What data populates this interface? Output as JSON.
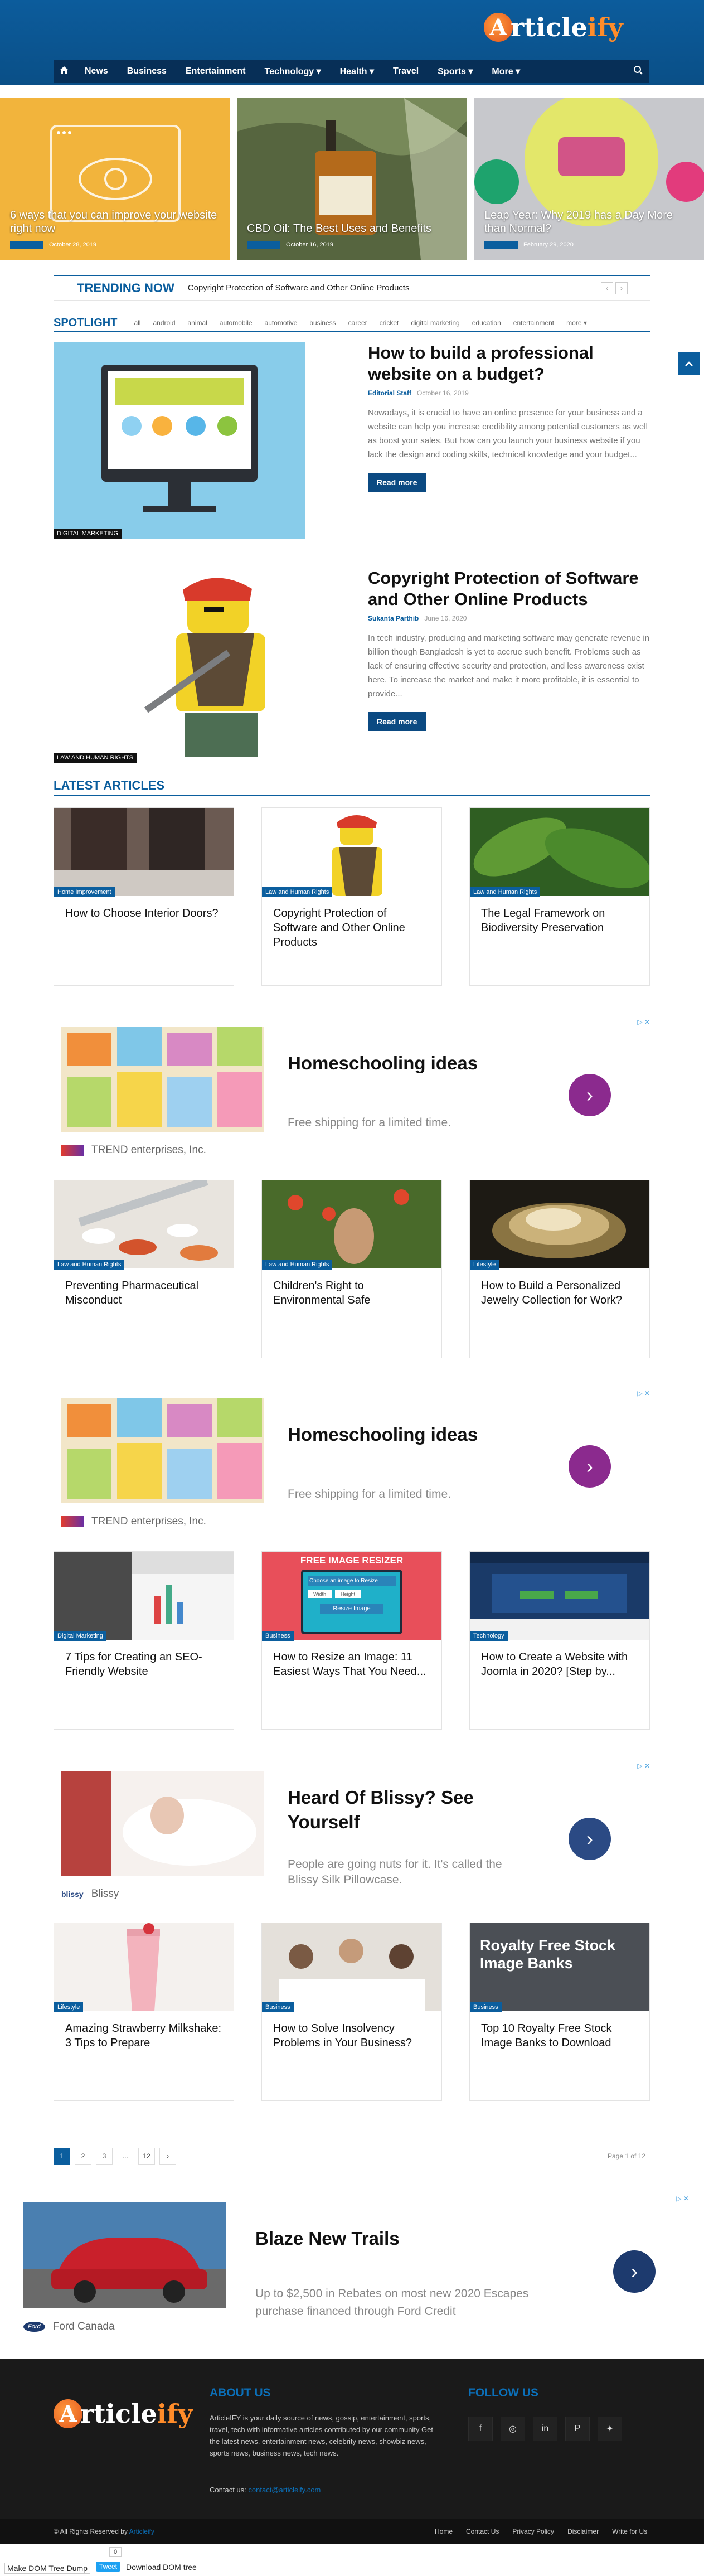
{
  "brand": {
    "logo_letter": "A",
    "logo_rest": "rticle",
    "logo_accent": "ify",
    "accent": "#0b5e9e",
    "header_bg": "#0a4f87"
  },
  "nav": {
    "items": [
      "News",
      "Business",
      "Entertainment",
      "Technology",
      "Health",
      "Travel",
      "Sports",
      "More"
    ],
    "dropdown_marker": "▾"
  },
  "hero": [
    {
      "title": "6 ways that you can improve your website right now",
      "date": "October 28, 2019"
    },
    {
      "title": "CBD Oil: The Best Uses and Benefits",
      "date": "October 16, 2019"
    },
    {
      "title": "Leap Year: Why 2019 has a Day More than Normal?",
      "date": "February 29, 2020"
    }
  ],
  "trending": {
    "label": "TRENDING NOW",
    "headline": "Copyright Protection of Software and Other Online Products",
    "prev": "‹",
    "next": "›"
  },
  "spotlight": {
    "label": "SPOTLIGHT",
    "filters": [
      "all",
      "android",
      "animal",
      "automobile",
      "automotive",
      "business",
      "career",
      "cricket",
      "digital marketing",
      "education",
      "entertainment",
      "more ▾"
    ],
    "posts": [
      {
        "category": "DIGITAL MARKETING",
        "title": "How to build a professional website on a budget?",
        "author": "Editorial Staff",
        "date": "October 16, 2019",
        "excerpt": "Nowadays, it is crucial to have an online presence for your business and a website can help you increase credibility among potential customers as well as boost your sales. But how can you launch your business website if you lack the design and coding skills, technical knowledge and your budget...",
        "button": "Read more"
      },
      {
        "category": "LAW AND HUMAN RIGHTS",
        "title": "Copyright Protection of Software and Other Online Products",
        "author": "Sukanta Parthib",
        "date": "June 16, 2020",
        "excerpt": "In tech industry, producing and marketing software may generate revenue in billion though Bangladesh is yet to accrue such benefit. Problems such as lack of ensuring effective security and protection, and less awareness exist here. To increase the market and make it more profitable, it is essential to provide...",
        "button": "Read more"
      }
    ]
  },
  "latest": {
    "label": "LATEST ARTICLES",
    "cards": [
      {
        "category": "Home Improvement",
        "title": "How to Choose Interior Doors?"
      },
      {
        "category": "Law and Human Rights",
        "title": "Copyright Protection of Software and Other Online Products"
      },
      {
        "category": "Law and Human Rights",
        "title": "The Legal Framework on Biodiversity Preservation"
      },
      {
        "category": "Law and Human Rights",
        "title": "Preventing Pharmaceutical Misconduct"
      },
      {
        "category": "Law and Human Rights",
        "title": "Children's Right to Environmental Safe"
      },
      {
        "category": "Lifestyle",
        "title": "How to Build a Personalized Jewelry Collection for Work?"
      },
      {
        "category": "Digital Marketing",
        "title": "7 Tips for Creating an SEO-Friendly Website"
      },
      {
        "category": "Business",
        "title": "How to Resize an Image: 11 Easiest Ways That You Need..."
      },
      {
        "category": "Technology",
        "title": "How to Create a Website with Joomla in 2020? [Step by..."
      },
      {
        "category": "Lifestyle",
        "title": "Amazing Strawberry Milkshake: 3 Tips to Prepare"
      },
      {
        "category": "Business",
        "title": "How to Solve Insolvency Problems in Your Business?"
      },
      {
        "category": "Business",
        "title": "Top 10 Royalty Free Stock Image Banks to Download"
      }
    ],
    "resizer_banner": "FREE IMAGE RESIZER",
    "resizer_input": "Choose an image to Resize",
    "resizer_width": "Width",
    "resizer_height": "Height",
    "resizer_btn": "Resize Image",
    "stock_banner": "Royalty Free Stock Image Banks"
  },
  "ads": [
    {
      "title": "Homeschooling ideas",
      "sub": "Free shipping for a limited time.",
      "advertiser": "TREND enterprises, Inc.",
      "go": "›",
      "adchoice": "▷ ✕"
    },
    {
      "title": "Homeschooling ideas",
      "sub": "Free shipping for a limited time.",
      "advertiser": "TREND enterprises, Inc.",
      "go": "›",
      "adchoice": "▷ ✕"
    },
    {
      "title": "Heard Of Blissy? See Yourself",
      "sub": "People are going nuts for it. It's called the Blissy Silk Pillowcase.",
      "advertiser": "Blissy",
      "logo": "blissy",
      "go": "›",
      "adchoice": "▷ ✕"
    },
    {
      "title": "Blaze New Trails",
      "sub": "Up to $2,500 in Rebates on most new 2020 Escapes purchase financed through Ford Credit",
      "advertiser": "Ford Canada",
      "logo": "Ford",
      "go": "›",
      "adchoice": "▷ ✕"
    }
  ],
  "pagination": {
    "pages": [
      "1",
      "2",
      "3",
      "...",
      "12",
      "›"
    ],
    "summary": "Page 1 of 12"
  },
  "footer": {
    "about_title": "ABOUT US",
    "about_text": "ArticleIFY is your daily source of news, gossip, entertainment, sports, travel, tech with informative articles contributed by our community Get the latest news, entertainment news, celebrity news, showbiz news, sports news, business news, tech news.",
    "contact_label": "Contact us:",
    "contact_email": "contact@articleify.com",
    "follow_title": "FOLLOW US",
    "social_icons": [
      "facebook-icon",
      "instagram-icon",
      "linkedin-icon",
      "pinterest-icon",
      "twitter-icon"
    ],
    "social_glyphs": [
      "f",
      "◎",
      "in",
      "P",
      "✦"
    ],
    "copyright": "© All Rights Reserved by",
    "copyright_link": "Articleify",
    "links": [
      "Home",
      "Contact Us",
      "Privacy Policy",
      "Disclaimer",
      "Write for Us"
    ]
  },
  "debug": {
    "dump": "Make DOM Tree Dump",
    "count": "0",
    "tweet": "Tweet",
    "download": "Download DOM tree"
  }
}
